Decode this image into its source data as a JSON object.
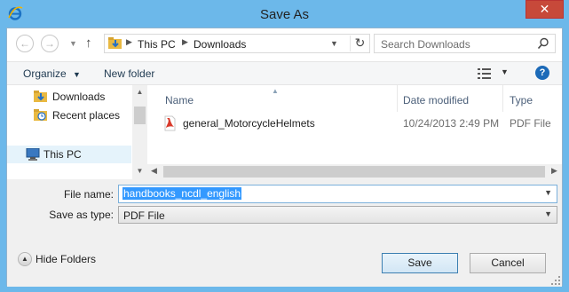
{
  "window": {
    "title": "Save As",
    "close_label": "✕"
  },
  "address": {
    "crumbs": [
      "This PC",
      "Downloads"
    ],
    "search_placeholder": "Search Downloads"
  },
  "toolbar": {
    "organize": "Organize",
    "new_folder": "New folder",
    "help": "?"
  },
  "nav": {
    "items": [
      {
        "label": "Downloads",
        "icon": "downloads-folder-icon"
      },
      {
        "label": "Recent places",
        "icon": "recent-places-icon"
      },
      {
        "label": "This PC",
        "icon": "computer-icon",
        "selected": true
      }
    ]
  },
  "files": {
    "columns": [
      "Name",
      "Date modified",
      "Type"
    ],
    "rows": [
      {
        "name": "general_MotorcycleHelmets",
        "date": "10/24/2013 2:49 PM",
        "type": "PDF File",
        "icon": "pdf-icon"
      }
    ]
  },
  "form": {
    "file_name_label": "File name:",
    "file_name_value": "handbooks_ncdl_english",
    "save_type_label": "Save as type:",
    "save_type_value": "PDF File"
  },
  "footer": {
    "hide_folders": "Hide Folders",
    "save": "Save",
    "cancel": "Cancel"
  },
  "colors": {
    "titlebar": "#6cb8ea",
    "close": "#c7493a",
    "selection": "#3399ff"
  }
}
